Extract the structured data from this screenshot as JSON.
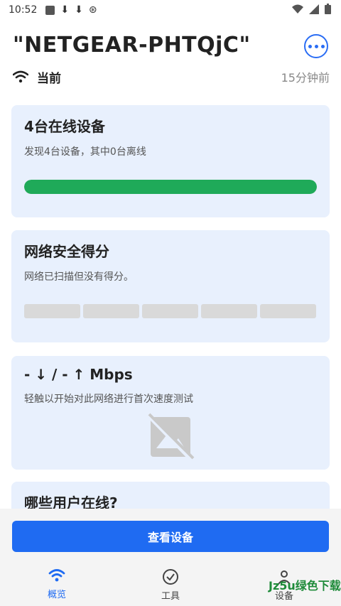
{
  "status_bar": {
    "time": "10:52"
  },
  "header": {
    "network_name": "\"NETGEAR-PHTQjC\"",
    "current_label": "当前",
    "time_since": "15分钟前"
  },
  "cards": {
    "devices": {
      "title": "4台在线设备",
      "description": "发现4台设备，其中0台离线",
      "online_fraction": 1.0
    },
    "security": {
      "title": "网络安全得分",
      "description": "网络已扫描但没有得分。"
    },
    "speed": {
      "title": "- ↓ / - ↑ Mbps",
      "description": "轻触以开始对此网络进行首次速度测试"
    },
    "users": {
      "title": "哪些用户在线?"
    }
  },
  "actions": {
    "view_devices": "查看设备"
  },
  "bottom_nav": [
    {
      "label": "概览",
      "icon": "wifi-icon",
      "active": true
    },
    {
      "label": "工具",
      "icon": "check-circle-icon",
      "active": false
    },
    {
      "label": "设备",
      "icon": "person-icon",
      "active": false
    }
  ],
  "watermark": "Jz5u绿色下载",
  "colors": {
    "accent": "#1f6bf2",
    "success": "#1faa59",
    "card_bg": "#e8f0fd"
  }
}
